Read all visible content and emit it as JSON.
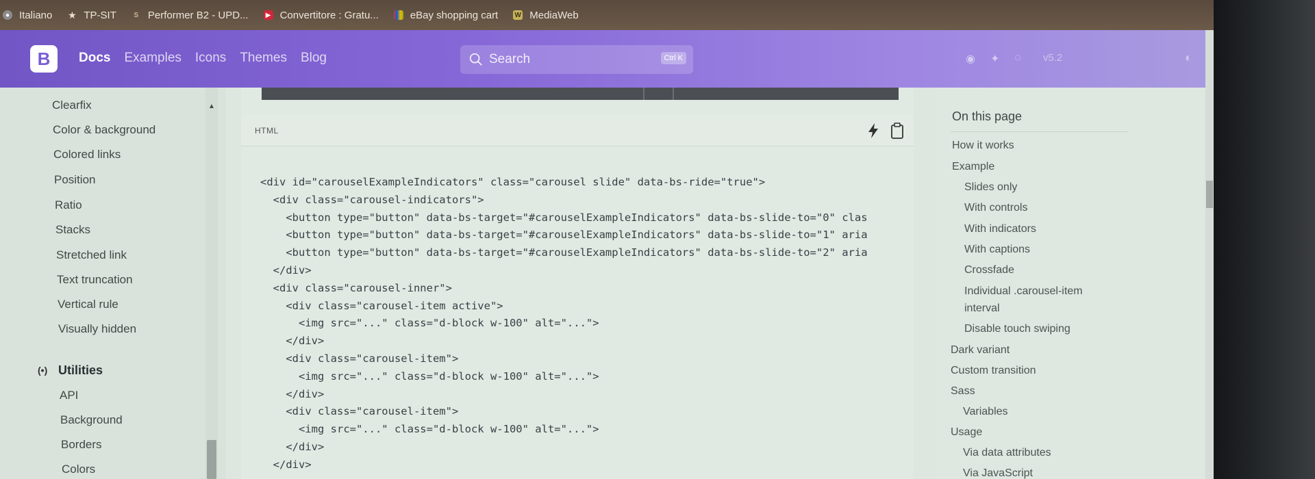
{
  "bookmarks": [
    {
      "label": "Italiano",
      "icon": "globe-icon"
    },
    {
      "label": "TP-SIT",
      "icon": "star-icon"
    },
    {
      "label": "Performer B2 - UPD...",
      "icon": "s-icon"
    },
    {
      "label": "Convertitore : Gratu...",
      "icon": "play-icon"
    },
    {
      "label": "eBay shopping cart",
      "icon": "bag-icon"
    },
    {
      "label": "MediaWeb",
      "icon": "w-icon"
    }
  ],
  "navbar": {
    "brand": "B",
    "links": [
      "Docs",
      "Examples",
      "Icons",
      "Themes",
      "Blog"
    ],
    "search_placeholder": "Search",
    "search_shortcut": "Ctrl K",
    "version": "v5.2"
  },
  "sidebar": {
    "items_top": [
      "Clearfix",
      "Color & background",
      "Colored links",
      "Position",
      "Ratio",
      "Stacks",
      "Stretched link",
      "Text truncation",
      "Vertical rule",
      "Visually hidden"
    ],
    "section": "Utilities",
    "items_bottom": [
      "API",
      "Background",
      "Borders",
      "Colors"
    ]
  },
  "code_block": {
    "language": "HTML",
    "lines": [
      "<div id=\"carouselExampleIndicators\" class=\"carousel slide\" data-bs-ride=\"true\">",
      "  <div class=\"carousel-indicators\">",
      "    <button type=\"button\" data-bs-target=\"#carouselExampleIndicators\" data-bs-slide-to=\"0\" clas",
      "    <button type=\"button\" data-bs-target=\"#carouselExampleIndicators\" data-bs-slide-to=\"1\" aria",
      "    <button type=\"button\" data-bs-target=\"#carouselExampleIndicators\" data-bs-slide-to=\"2\" aria",
      "  </div>",
      "  <div class=\"carousel-inner\">",
      "    <div class=\"carousel-item active\">",
      "      <img src=\"...\" class=\"d-block w-100\" alt=\"...\">",
      "    </div>",
      "    <div class=\"carousel-item\">",
      "      <img src=\"...\" class=\"d-block w-100\" alt=\"...\">",
      "    </div>",
      "    <div class=\"carousel-item\">",
      "      <img src=\"...\" class=\"d-block w-100\" alt=\"...\">",
      "    </div>",
      "  </div>"
    ]
  },
  "toc": {
    "title": "On this page",
    "items": [
      {
        "label": "How it works",
        "level": 1
      },
      {
        "label": "Example",
        "level": 1
      },
      {
        "label": "Slides only",
        "level": 2
      },
      {
        "label": "With controls",
        "level": 2
      },
      {
        "label": "With indicators",
        "level": 2
      },
      {
        "label": "With captions",
        "level": 2
      },
      {
        "label": "Crossfade",
        "level": 2
      },
      {
        "label": "Individual .carousel-item",
        "level": 2
      },
      {
        "label": "interval",
        "level": 2
      },
      {
        "label": "Disable touch swiping",
        "level": 2
      },
      {
        "label": "Dark variant",
        "level": 1
      },
      {
        "label": "Custom transition",
        "level": 1
      },
      {
        "label": "Sass",
        "level": 1
      },
      {
        "label": "Variables",
        "level": 2
      },
      {
        "label": "Usage",
        "level": 1
      },
      {
        "label": "Via data attributes",
        "level": 2
      },
      {
        "label": "Via JavaScript",
        "level": 2
      }
    ]
  },
  "colors": {
    "navbar_start": "#7256c6",
    "navbar_end": "#a89ae0",
    "page_bg": "#dde6df"
  }
}
